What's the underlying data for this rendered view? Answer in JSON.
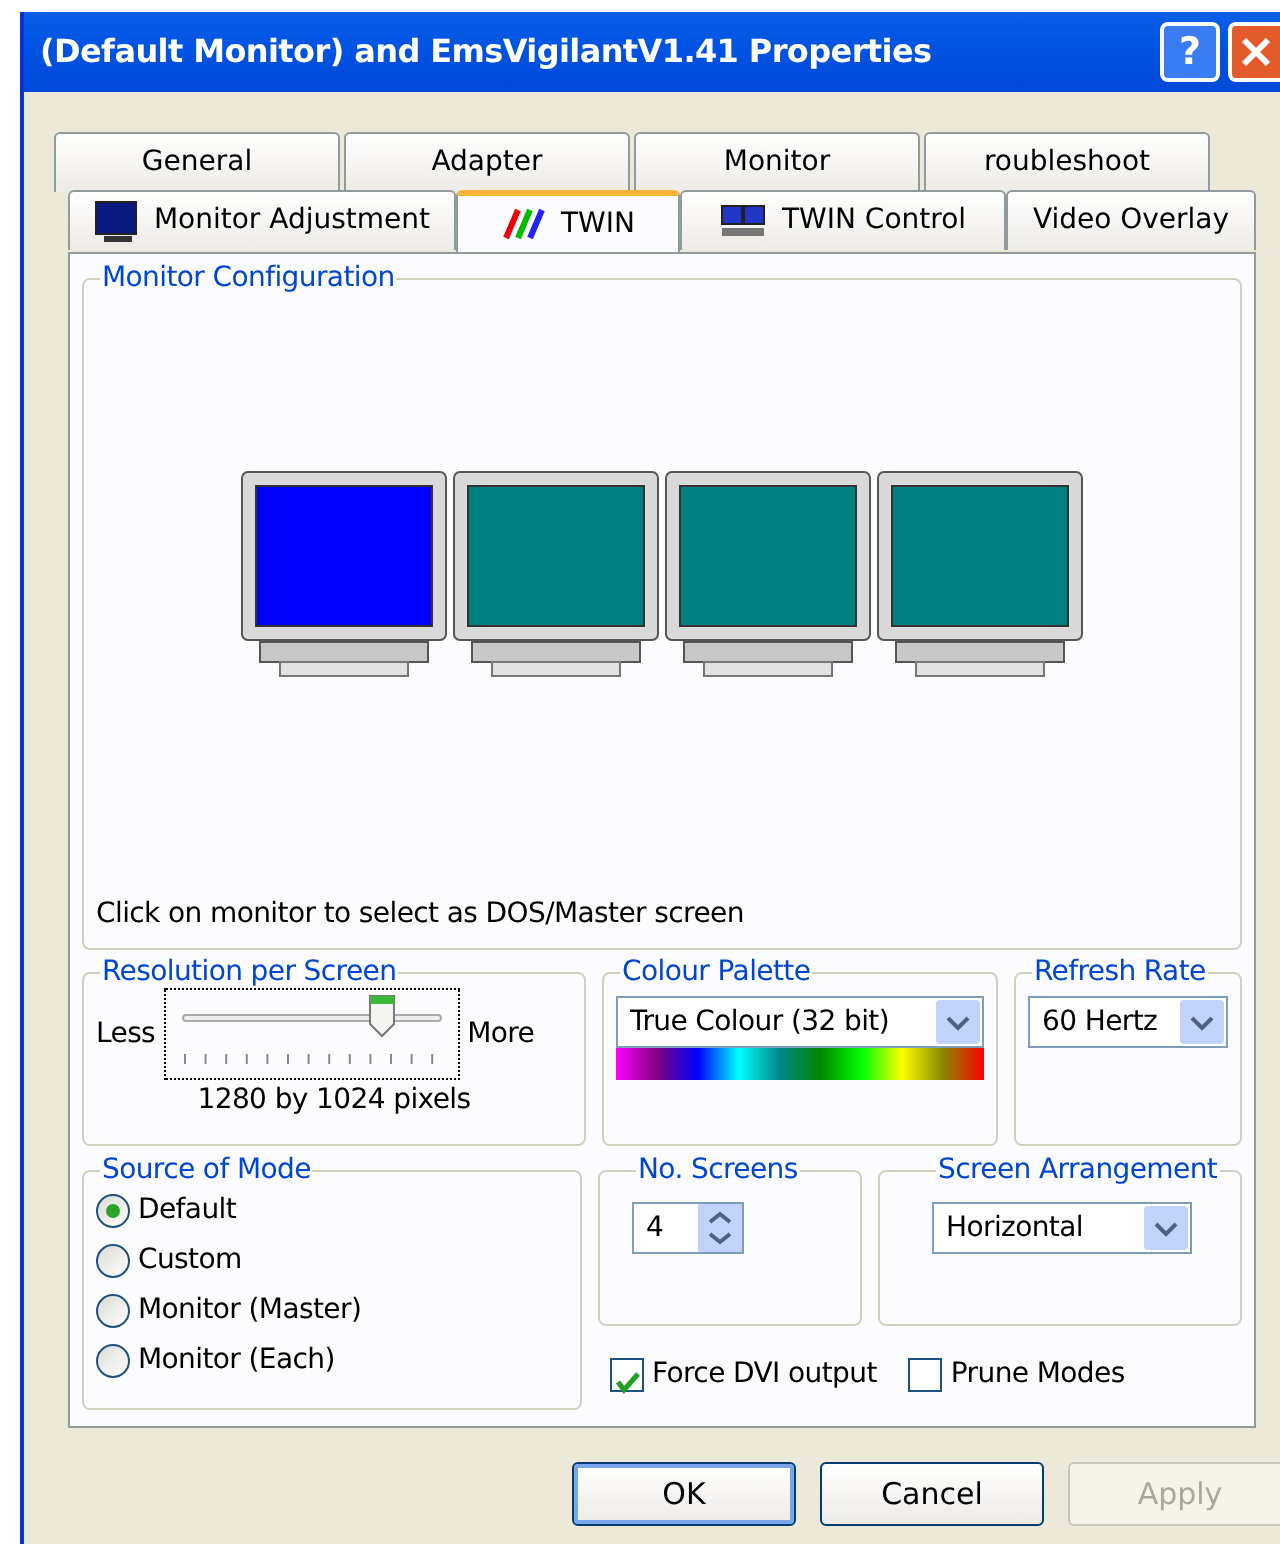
{
  "window": {
    "title": "(Default Monitor) and EmsVigilantV1.41 Properties",
    "help": "?"
  },
  "tabs_top": [
    {
      "label": "General",
      "selected": false
    },
    {
      "label": "Adapter",
      "selected": false
    },
    {
      "label": "Monitor",
      "selected": false
    },
    {
      "label": "roubleshoot",
      "selected": false
    }
  ],
  "tabs": [
    {
      "label": "Monitor Adjustment",
      "selected": false
    },
    {
      "label": "TWIN",
      "selected": true
    },
    {
      "label": "TWIN Control",
      "selected": false
    },
    {
      "label": "Video Overlay",
      "selected": false
    }
  ],
  "monitor_configuration": {
    "title": "Monitor Configuration",
    "monitors": [
      {
        "selected": true
      },
      {
        "selected": false
      },
      {
        "selected": false
      },
      {
        "selected": false
      }
    ],
    "hint": "Click on monitor to select as DOS/Master screen"
  },
  "resolution": {
    "title": "Resolution per Screen",
    "less": "Less",
    "more": "More",
    "level": 0.8,
    "reading": "1280 by 1024 pixels"
  },
  "colour_palette": {
    "title": "Colour Palette",
    "value": "True Colour (32 bit)"
  },
  "refresh_rate": {
    "title": "Refresh Rate",
    "value": "60 Hertz"
  },
  "source_of_mode": {
    "title": "Source of Mode",
    "options": [
      {
        "label": "Default",
        "selected": true
      },
      {
        "label": "Custom",
        "selected": false
      },
      {
        "label": "Monitor (Master)",
        "selected": false
      },
      {
        "label": "Monitor (Each)",
        "selected": false
      }
    ]
  },
  "screens": {
    "title": "No. Screens",
    "value": "4"
  },
  "arrangement": {
    "title": "Screen Arrangement",
    "value": "Horizontal"
  },
  "options": [
    {
      "label": "Force DVI output",
      "checked": true
    },
    {
      "label": "Prune Modes",
      "checked": false
    }
  ],
  "buttons": [
    {
      "label": "OK",
      "default": true,
      "disabled": false
    },
    {
      "label": "Cancel",
      "default": false,
      "disabled": false
    },
    {
      "label": "Apply",
      "default": false,
      "disabled": true
    }
  ]
}
